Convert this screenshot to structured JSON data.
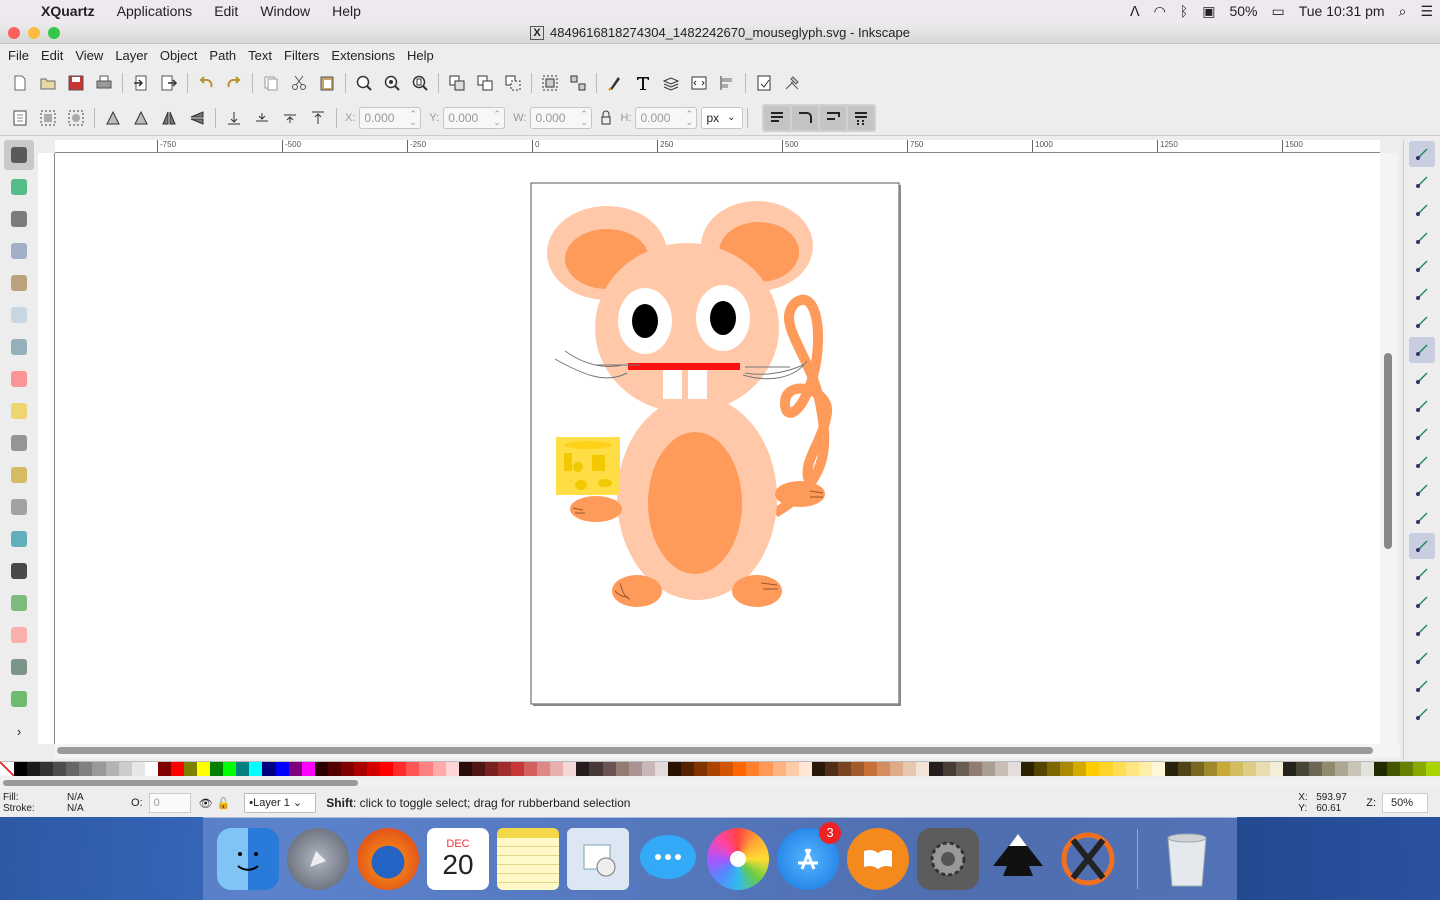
{
  "menubar": {
    "app": "XQuartz",
    "items": [
      "Applications",
      "Edit",
      "Window",
      "Help"
    ],
    "battery": "50%",
    "clock": "Tue 10:31 pm"
  },
  "window": {
    "title": "4849616818274304_1482242670_mouseglyph.svg - Inkscape"
  },
  "appmenu": [
    "File",
    "Edit",
    "View",
    "Layer",
    "Object",
    "Path",
    "Text",
    "Filters",
    "Extensions",
    "Help"
  ],
  "controls": {
    "x_label": "X:",
    "x_value": "0.000",
    "y_label": "Y:",
    "y_value": "0.000",
    "w_label": "W:",
    "w_value": "0.000",
    "h_label": "H:",
    "h_value": "0.000",
    "unit": "px"
  },
  "ruler": {
    "ticks": [
      "-750",
      "-500",
      "-250",
      "0",
      "250",
      "500",
      "750",
      "1000",
      "1250",
      "1500"
    ]
  },
  "status": {
    "fill_label": "Fill:",
    "fill_value": "N/A",
    "stroke_label": "Stroke:",
    "stroke_value": "N/A",
    "opacity_label": "O:",
    "opacity_value": "0",
    "layer": "•Layer 1",
    "message_key": "Shift",
    "message": ": click to toggle select; drag for rubberband selection",
    "x_label": "X:",
    "x_value": "593.97",
    "y_label": "Y:",
    "y_value": "60.61",
    "zoom_label": "Z:",
    "zoom_value": "50%"
  },
  "dock": {
    "calendar_month": "DEC",
    "calendar_day": "20",
    "appstore_badge": "3"
  },
  "palette": [
    "#000000",
    "#1a1a1a",
    "#333333",
    "#4d4d4d",
    "#666666",
    "#808080",
    "#999999",
    "#b3b3b3",
    "#cccccc",
    "#e6e6e6",
    "#ffffff",
    "#800000",
    "#ff0000",
    "#808000",
    "#ffff00",
    "#008000",
    "#00ff00",
    "#008080",
    "#00ffff",
    "#000080",
    "#0000ff",
    "#800080",
    "#ff00ff",
    "#2b0000",
    "#550000",
    "#800000",
    "#aa0000",
    "#d40000",
    "#ff0000",
    "#ff2a2a",
    "#ff5555",
    "#ff8080",
    "#ffaaaa",
    "#ffd5d5",
    "#280b0b",
    "#501616",
    "#782121",
    "#a02c2c",
    "#c83737",
    "#d35f5f",
    "#de8787",
    "#e9afaf",
    "#f4d7d7",
    "#241c1c",
    "#483737",
    "#6c5353",
    "#917c6f",
    "#ac9393",
    "#c8b7b7",
    "#e3dbdb",
    "#2b1100",
    "#552200",
    "#803300",
    "#aa4400",
    "#d45500",
    "#ff6600",
    "#ff7f2a",
    "#ff9955",
    "#ffb380",
    "#ffccaa",
    "#ffe6d5",
    "#28170b",
    "#502d16",
    "#784421",
    "#a05a2c",
    "#c87137",
    "#d38d5f",
    "#deaa87",
    "#e9c6af",
    "#f4e3d7",
    "#241f1c",
    "#483e37",
    "#6c5d53",
    "#917c6f",
    "#ac9d93",
    "#c8beb7",
    "#e3dedb",
    "#2b2200",
    "#554400",
    "#806600",
    "#aa8800",
    "#d4aa00",
    "#ffcc00",
    "#ffd42a",
    "#ffdd55",
    "#ffe680",
    "#ffeeaa",
    "#fff6d5",
    "#28220b",
    "#504416",
    "#786721",
    "#a0892c",
    "#c8ab37",
    "#d3bc5f",
    "#decd87",
    "#e9ddaf",
    "#f4eed7",
    "#24221c",
    "#484537",
    "#6c6753",
    "#918a6f",
    "#aca793",
    "#c8c4b7",
    "#e3e2db",
    "#222b00",
    "#445500",
    "#668000",
    "#88aa00",
    "#aad400"
  ]
}
